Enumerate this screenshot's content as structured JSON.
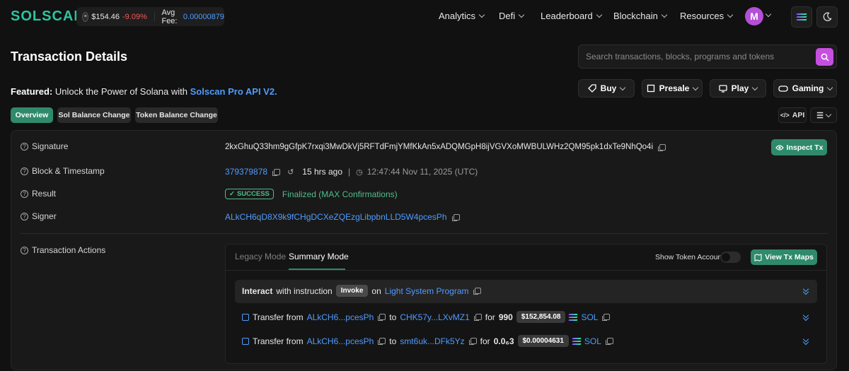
{
  "nav": {
    "logo": "SOLSCAN",
    "sol_price": "$154.46",
    "sol_change": "-9.09%",
    "avg_fee_label": "Avg Fee:",
    "avg_fee_value": "0.00000879",
    "menu": [
      "Analytics",
      "Defi",
      "Leaderboard",
      "Blockchain",
      "Resources"
    ],
    "avatar_letter": "M"
  },
  "page": {
    "title": "Transaction Details",
    "search_placeholder": "Search transactions, blocks, programs and tokens"
  },
  "featured": {
    "prefix": "Featured:",
    "text": " Unlock the Power of Solana with ",
    "link": "Solscan Pro API V2."
  },
  "promo_buttons": [
    "Buy",
    "Presale",
    "Play",
    "Gaming"
  ],
  "tabs": [
    "Overview",
    "Sol Balance Change",
    "Token Balance Change"
  ],
  "api_label": "API",
  "details": {
    "signature_label": "Signature",
    "signature": "2kxGhuQ33hm9gGfpK7rxqi3MwDkVj5RFTdFmjYMfKkAn5xADQMGpH8ijVGVXoMWBULWHz2QM95pk1dxTe9NhQo4i",
    "inspect_label": "Inspect Tx",
    "block_label": "Block & Timestamp",
    "block": "379379878",
    "age": "15 hrs ago",
    "timestamp": "12:47:44 Nov 11, 2025 (UTC)",
    "result_label": "Result",
    "result_badge": "SUCCESS",
    "result_text": "Finalized (MAX Confirmations)",
    "signer_label": "Signer",
    "signer": "ALkCH6qD8X9k9fCHgDCXeZQEzgLibpbnLLD5W4pcesPh",
    "actions_label": "Transaction Actions"
  },
  "actions": {
    "mode_legacy": "Legacy Mode",
    "mode_summary": "Summary Mode",
    "show_token_account": "Show Token Account",
    "view_maps": "View Tx Maps",
    "interact": {
      "bold": "Interact",
      "text": "with instruction",
      "instruction": "Invoke",
      "on": "on",
      "program": "Light System Program"
    },
    "transfers": [
      {
        "label": "Transfer from",
        "from": "ALkCH6...pcesPh",
        "to_word": "to",
        "to": "CHK57y...LXvMZ1",
        "for_word": "for",
        "amount": "990",
        "usd": "$152,854.08",
        "token": "SOL"
      },
      {
        "label": "Transfer from",
        "from": "ALkCH6...pcesPh",
        "to_word": "to",
        "to": "smt6uk...DFk5Yz",
        "for_word": "for",
        "amount": "0.0₆3",
        "usd": "$0.00004631",
        "token": "SOL"
      }
    ]
  },
  "colors": {
    "accent": "#2f8a6c",
    "link": "#4f9cff",
    "brand": "#2ec4a0",
    "negative": "#f05a5a"
  }
}
